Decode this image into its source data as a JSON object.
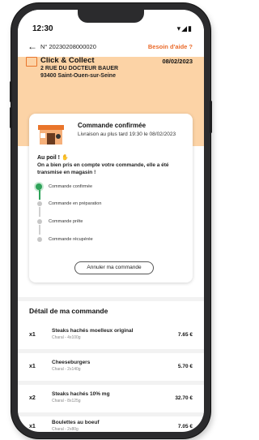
{
  "status_bar": {
    "time": "12:30",
    "icons": "▾◢▮"
  },
  "header": {
    "back_icon": "arrow-left-icon",
    "order_number": "N° 20230208000020",
    "help_link": "Besoin d'aide ?"
  },
  "store": {
    "title": "Click & Collect",
    "date": "08/02/2023",
    "address_line1": "2 RUE DU DOCTEUR BAUER",
    "address_line2": "93400 Saint-Ouen-sur-Seine"
  },
  "confirmation": {
    "title": "Commande confirmée",
    "subtitle": "Livraison au plus tard 19:30 le 08/02/2023",
    "greeting": "Au poil ! ✋",
    "message": "On a bien pris en compte votre commande, elle a été transmise en magasin !"
  },
  "steps": [
    {
      "label": "Commande confirmée",
      "active": true
    },
    {
      "label": "Commande en préparation",
      "active": false
    },
    {
      "label": "Commande prête",
      "active": false
    },
    {
      "label": "Commande récupérée",
      "active": false
    }
  ],
  "cancel_button": "Annuler ma commande",
  "detail": {
    "title": "Détail de ma commande",
    "items": [
      {
        "qty": "x1",
        "name": "Steaks hachés moelleux original",
        "desc": "Charal - 4x100g",
        "price": "7.65 €"
      },
      {
        "qty": "x1",
        "name": "Cheeseburgers",
        "desc": "Charal - 2x140g",
        "price": "5.70 €"
      },
      {
        "qty": "x2",
        "name": "Steaks hachés 10% mg",
        "desc": "Charal - 8x125g",
        "price": "32.70 €"
      },
      {
        "qty": "x1",
        "name": "Boulettes au boeuf",
        "desc": "Charal - 2x80g",
        "price": "7.05 €"
      }
    ]
  },
  "colors": {
    "accent": "#ea6a2a",
    "banner": "#fcd3a6",
    "success": "#2fa35a"
  }
}
